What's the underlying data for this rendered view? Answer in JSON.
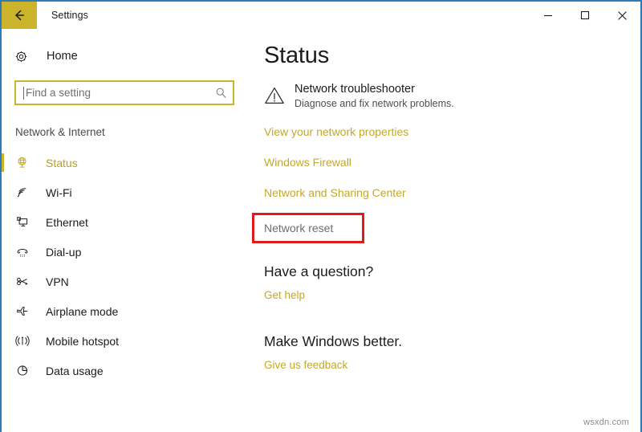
{
  "window": {
    "title": "Settings",
    "back_icon": "back-arrow-icon",
    "controls": {
      "minimize": "minimize-icon",
      "maximize": "maximize-icon",
      "close": "close-icon"
    }
  },
  "colors": {
    "accent": "#cbb42c",
    "accent_text": "#c4a828",
    "selected_text": "#b7a021",
    "highlight_box": "#e01b1b",
    "window_border": "#2e7ab8",
    "muted_text": "#6d6d6d"
  },
  "sidebar": {
    "home_label": "Home",
    "home_icon": "gear-icon",
    "search": {
      "placeholder": "Find a setting",
      "value": "",
      "icon": "search-icon"
    },
    "section_title": "Network & Internet",
    "items": [
      {
        "label": "Status",
        "icon": "network-status-icon",
        "selected": true
      },
      {
        "label": "Wi-Fi",
        "icon": "wifi-icon",
        "selected": false
      },
      {
        "label": "Ethernet",
        "icon": "ethernet-icon",
        "selected": false
      },
      {
        "label": "Dial-up",
        "icon": "dialup-phone-icon",
        "selected": false
      },
      {
        "label": "VPN",
        "icon": "vpn-key-icon",
        "selected": false
      },
      {
        "label": "Airplane mode",
        "icon": "airplane-icon",
        "selected": false
      },
      {
        "label": "Mobile hotspot",
        "icon": "hotspot-icon",
        "selected": false
      },
      {
        "label": "Data usage",
        "icon": "pie-chart-icon",
        "selected": false
      }
    ]
  },
  "main": {
    "page_title": "Status",
    "troubleshooter": {
      "icon": "warning-triangle-icon",
      "title": "Network troubleshooter",
      "subtitle": "Diagnose and fix network problems."
    },
    "links": [
      {
        "label": "View your network properties",
        "style": "accent"
      },
      {
        "label": "Windows Firewall",
        "style": "accent"
      },
      {
        "label": "Network and Sharing Center",
        "style": "accent"
      }
    ],
    "network_reset": {
      "label": "Network reset",
      "highlighted": true
    },
    "question_section": {
      "heading": "Have a question?",
      "link": "Get help"
    },
    "feedback_section": {
      "heading": "Make Windows better.",
      "link": "Give us feedback"
    }
  },
  "watermark": "wsxdn.com"
}
